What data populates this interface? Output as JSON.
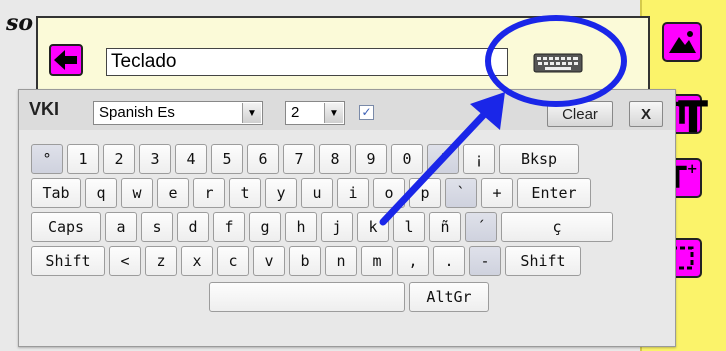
{
  "background_fragment": "so",
  "input": {
    "value": "Teclado"
  },
  "vki": {
    "title": "VKI",
    "layout_select": "Spanish Es",
    "size_select": "2",
    "checkbox_checked": true,
    "clear_label": "Clear",
    "close_label": "X",
    "row1": [
      "°",
      "1",
      "2",
      "3",
      "4",
      "5",
      "6",
      "7",
      "8",
      "9",
      "0",
      "'",
      "¡",
      "Bksp"
    ],
    "row2": [
      "Tab",
      "q",
      "w",
      "e",
      "r",
      "t",
      "y",
      "u",
      "i",
      "o",
      "p",
      "`",
      "+",
      "Enter"
    ],
    "row3": [
      "Caps",
      "a",
      "s",
      "d",
      "f",
      "g",
      "h",
      "j",
      "k",
      "l",
      "ñ",
      "´",
      "ç"
    ],
    "row4": [
      "Shift",
      "<",
      "z",
      "x",
      "c",
      "v",
      "b",
      "n",
      "m",
      ",",
      ".",
      "-",
      "Shift"
    ],
    "row5": [
      "",
      "AltGr"
    ]
  },
  "toolbar": {
    "text_button_label": "T",
    "text_plus_label": "T",
    "text_plus_superscript": "+"
  },
  "colors": {
    "accent_magenta": "#ff00ff",
    "toolbar_yellow": "#fbf36a",
    "annotation_blue": "#1a26e8"
  }
}
